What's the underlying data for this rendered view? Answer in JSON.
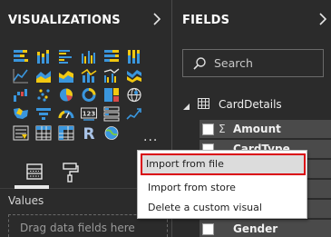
{
  "visualizations": {
    "title": "VISUALIZATIONS",
    "values_label": "Values",
    "drop_hint": "Drag data fields here"
  },
  "fields": {
    "title": "FIELDS",
    "search_placeholder": "Search",
    "table_name": "CardDetails",
    "items": [
      {
        "label": "Amount",
        "checked": false,
        "aggregate": true
      },
      {
        "label": "CardType",
        "checked": false,
        "aggregate": false
      },
      {
        "label": "",
        "checked": false,
        "aggregate": false
      },
      {
        "label": "",
        "checked": false,
        "aggregate": false
      },
      {
        "label": "",
        "checked": false,
        "aggregate": false
      },
      {
        "label": "Gender",
        "checked": false,
        "aggregate": false
      }
    ]
  },
  "context_menu": {
    "items": [
      "Import from file",
      "Import from store",
      "Delete a custom visual"
    ],
    "highlighted_index": 0,
    "highlight_color": "#d9000d"
  },
  "colors": {
    "pane_bg": "#2b2b2b",
    "field_row_bg": "#4a4a4a",
    "accent_yellow": "#f2c811",
    "accent_blue": "#3a96dd",
    "accent_red": "#d94a4a"
  }
}
